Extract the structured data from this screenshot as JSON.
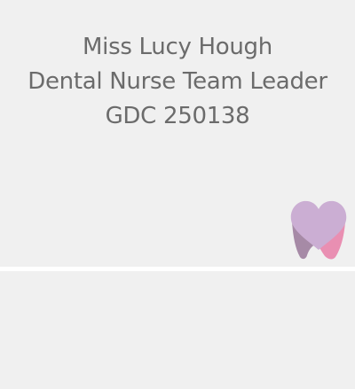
{
  "profile": {
    "name": "Miss Lucy Hough",
    "role": "Dental Nurse Team Leader",
    "registration": "GDC 250138"
  },
  "logo": {
    "icon": "tooth-heart-icon",
    "colors": {
      "heart": "#cbaed3",
      "left_root": "#a68aa6",
      "right_root": "#e98fb2"
    }
  },
  "colors": {
    "background": "#f0f0f0",
    "text": "#6b6b6b",
    "divider": "#ffffff"
  }
}
